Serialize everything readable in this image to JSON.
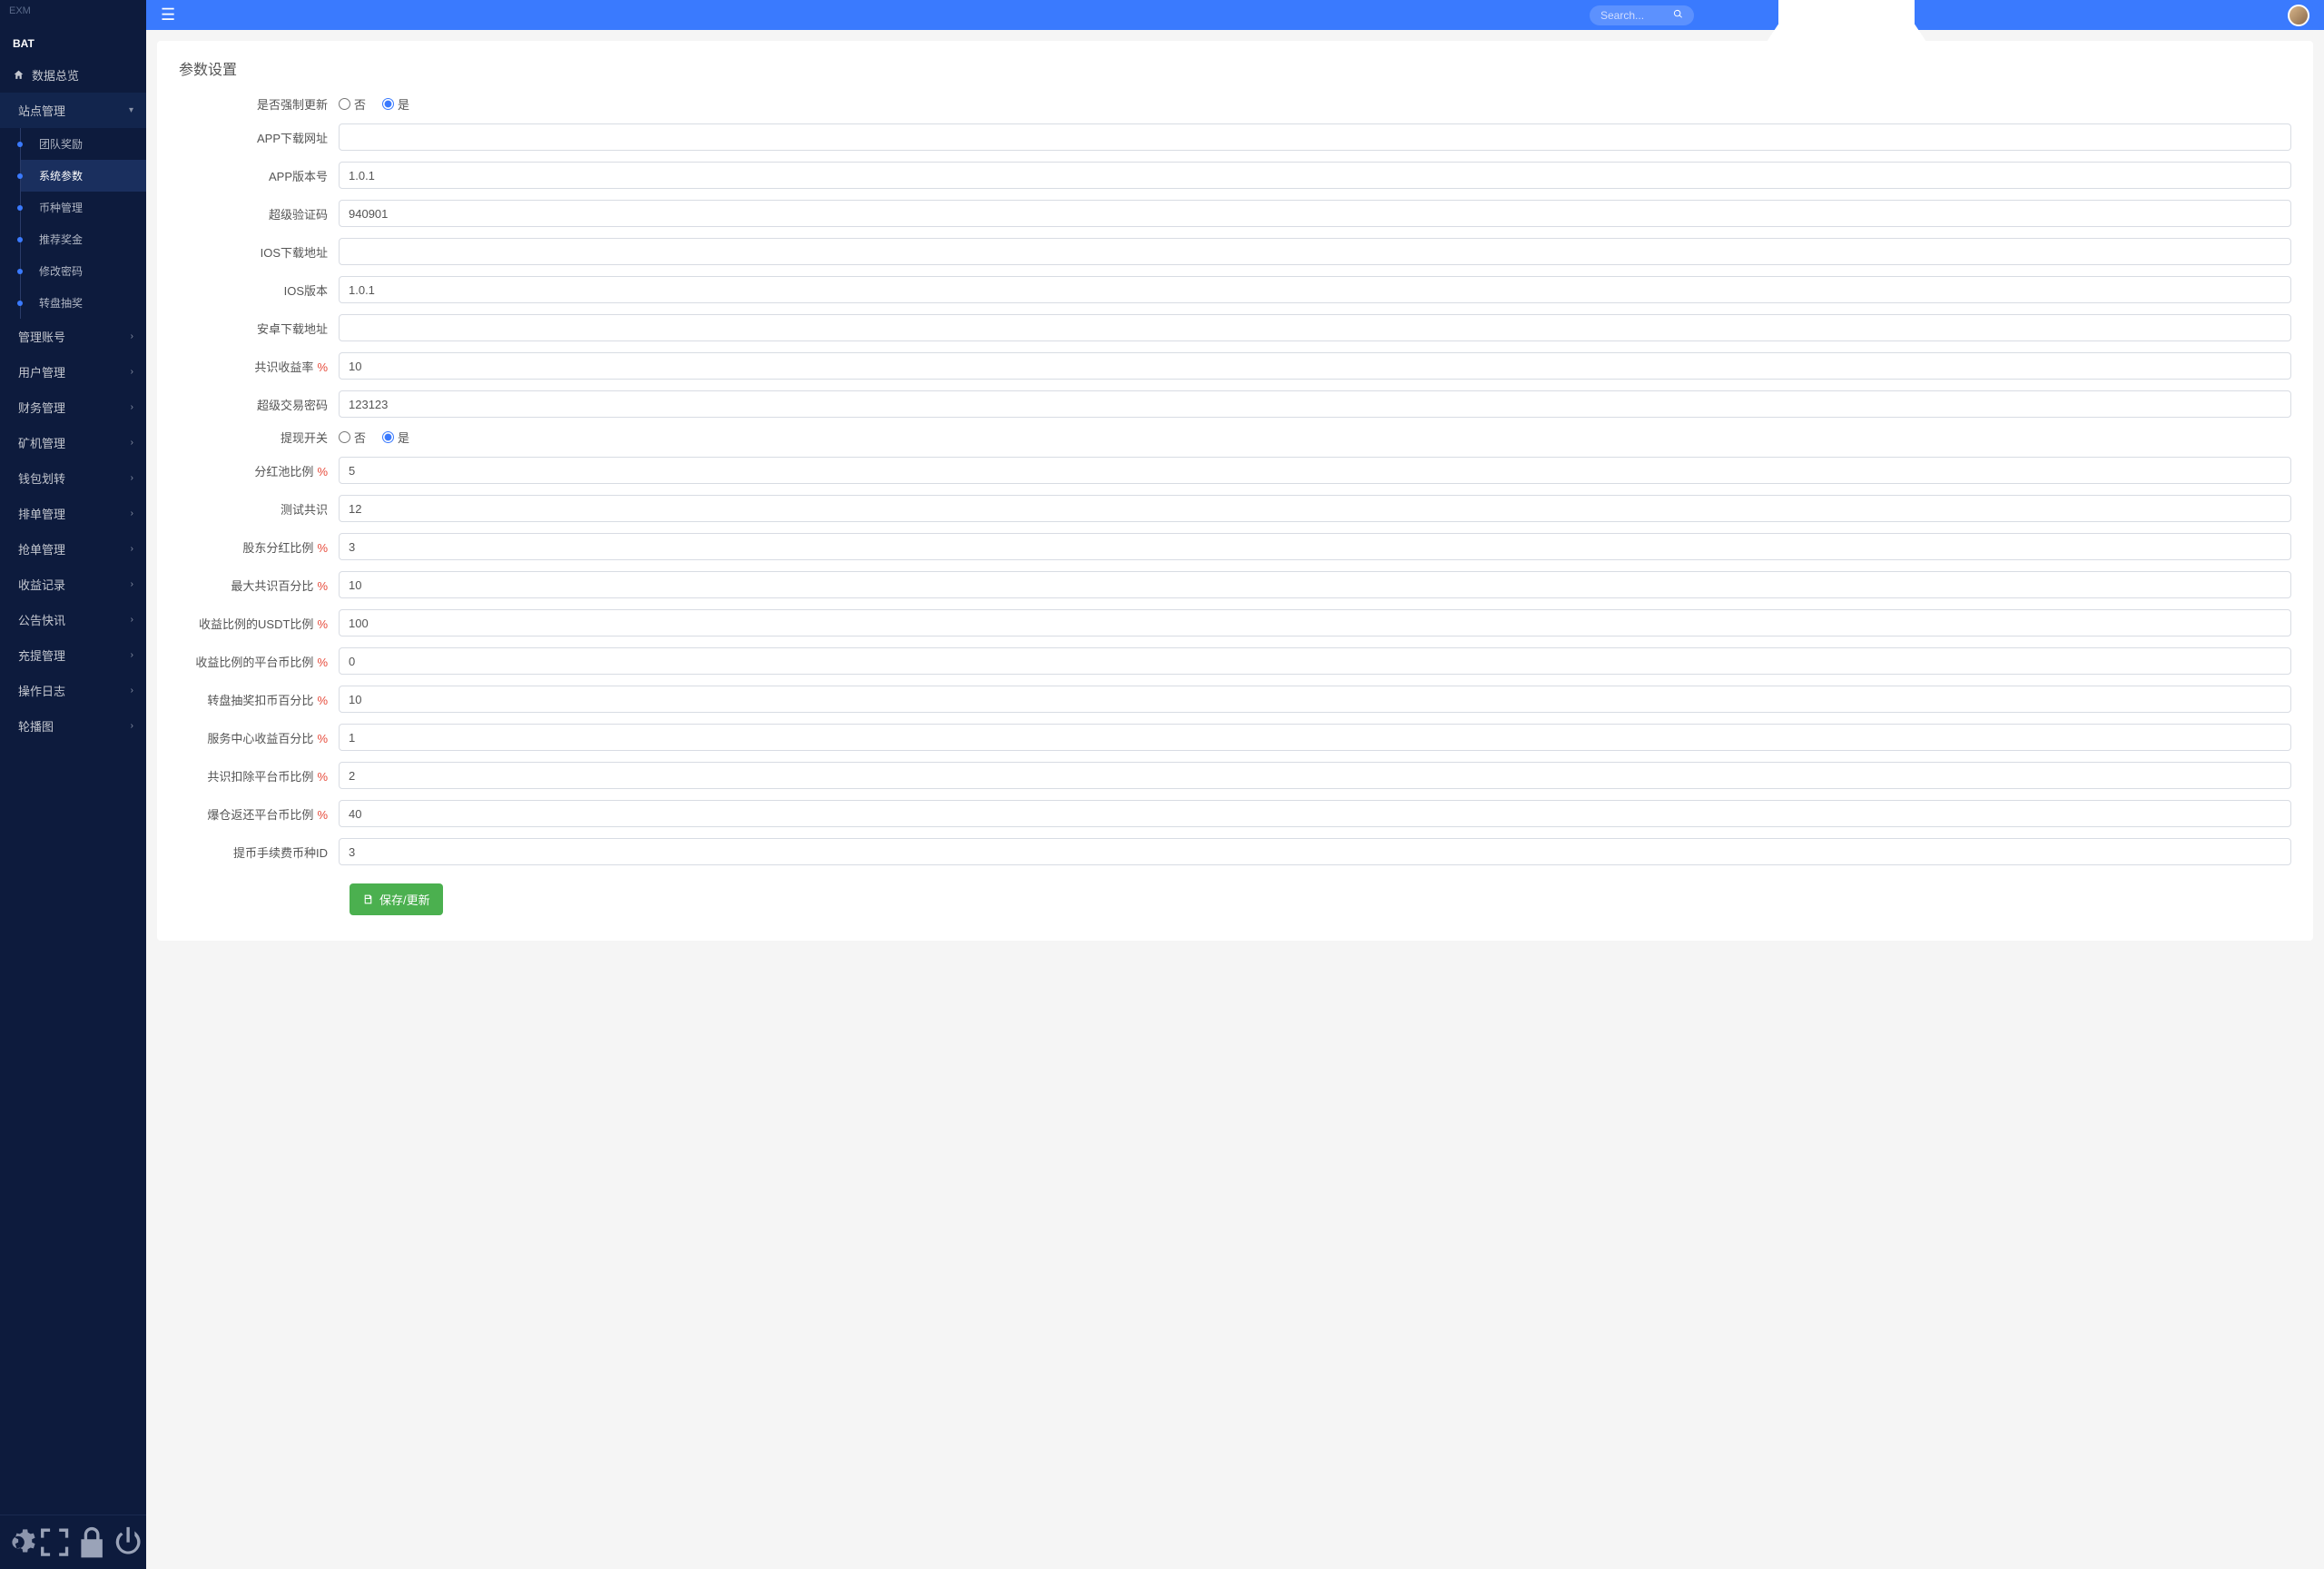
{
  "logo_text": "EXM",
  "brand": "BAT",
  "search_placeholder": "Search...",
  "sidebar": {
    "home": "数据总览",
    "site_mgmt": "站点管理",
    "sub": {
      "team_reward": "团队奖励",
      "sys_params": "系统参数",
      "coin_mgmt": "币种管理",
      "rec_bonus": "推荐奖金",
      "change_pwd": "修改密码",
      "lottery": "转盘抽奖"
    },
    "items": {
      "admin_acct": "管理账号",
      "user_mgmt": "用户管理",
      "finance": "财务管理",
      "miner": "矿机管理",
      "wallet_xfer": "钱包划转",
      "rank": "排单管理",
      "grab": "抢单管理",
      "profit_log": "收益记录",
      "notice": "公告快讯",
      "deposit": "充提管理",
      "op_log": "操作日志",
      "carousel": "轮播图"
    }
  },
  "page": {
    "title": "参数设置",
    "radio_no": "否",
    "radio_yes": "是",
    "labels": {
      "force_update": "是否强制更新",
      "app_url": "APP下载网址",
      "app_version": "APP版本号",
      "super_code": "超级验证码",
      "ios_url": "IOS下载地址",
      "ios_version": "IOS版本",
      "android_url": "安卓下载地址",
      "consensus_rate": "共识收益率",
      "super_trade_pwd": "超级交易密码",
      "withdraw_switch": "提现开关",
      "dividend_pool_ratio": "分红池比例",
      "test_consensus": "测试共识",
      "shareholder_div_ratio": "股东分红比例",
      "max_consensus_pct": "最大共识百分比",
      "profit_usdt_ratio": "收益比例的USDT比例",
      "profit_platform_ratio": "收益比例的平台币比例",
      "lottery_deduct_pct": "转盘抽奖扣币百分比",
      "service_center_pct": "服务中心收益百分比",
      "consensus_deduct_platform": "共识扣除平台币比例",
      "liquidation_return_ratio": "爆仓返还平台币比例",
      "withdraw_fee_coin_id": "提币手续费币种ID"
    },
    "values": {
      "force_update": "是",
      "app_url": "",
      "app_version": "1.0.1",
      "super_code": "940901",
      "ios_url": "",
      "ios_version": "1.0.1",
      "android_url": "",
      "consensus_rate": "10",
      "super_trade_pwd": "123123",
      "withdraw_switch": "是",
      "dividend_pool_ratio": "5",
      "test_consensus": "12",
      "shareholder_div_ratio": "3",
      "max_consensus_pct": "10",
      "profit_usdt_ratio": "100",
      "profit_platform_ratio": "0",
      "lottery_deduct_pct": "10",
      "service_center_pct": "1",
      "consensus_deduct_platform": "2",
      "liquidation_return_ratio": "40",
      "withdraw_fee_coin_id": "3"
    },
    "save_button": "保存/更新"
  }
}
